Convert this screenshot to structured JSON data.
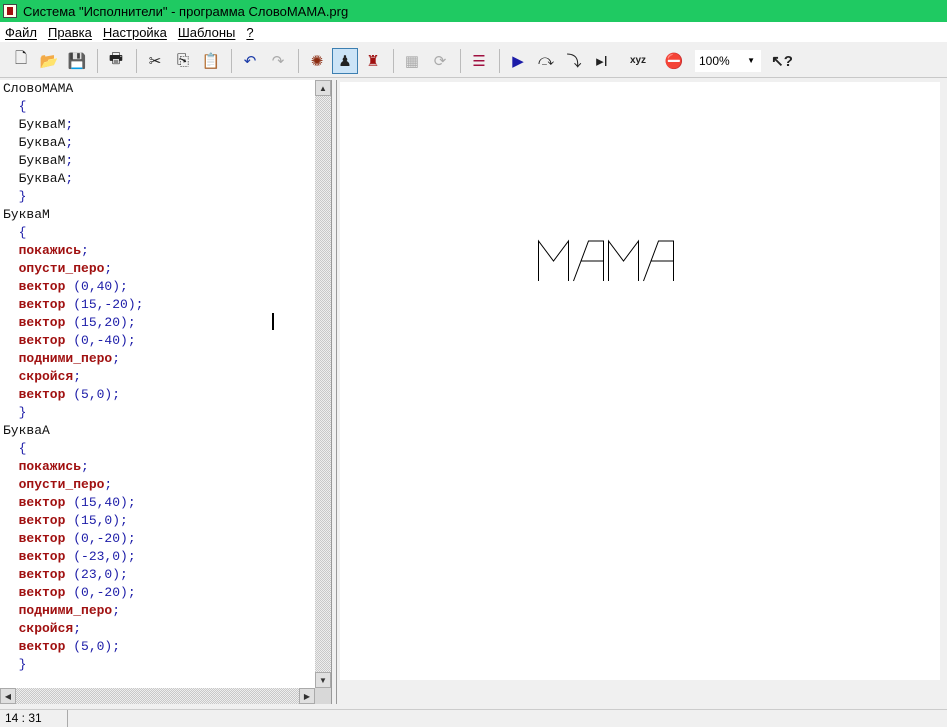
{
  "window": {
    "title": "Система \"Исполнители\" - программа СловоМАМА.prg"
  },
  "menu": [
    "Файл",
    "Правка",
    "Настройка",
    "Шаблоны",
    "?"
  ],
  "toolbar": {
    "zoom": "100%",
    "icons": [
      "new-file-icon",
      "open-folder-icon",
      "save-icon",
      "print-icon",
      "cut-icon",
      "copy-icon",
      "paste-icon",
      "undo-icon",
      "redo-icon",
      "turtle-icon",
      "artist-icon",
      "robot-icon",
      "grid-icon",
      "refresh-icon",
      "format-icon",
      "run-icon",
      "step-over-icon",
      "step-into-icon",
      "run-to-cursor-icon",
      "variables-icon",
      "stop-icon",
      "help-cursor-icon"
    ]
  },
  "code": [
    [
      [
        "pl",
        "СловоМАМА"
      ]
    ],
    [
      [
        "bl",
        "  {"
      ]
    ],
    [
      [
        "pl",
        "  БуквaM"
      ],
      [
        "bl",
        ";"
      ]
    ],
    [
      [
        "pl",
        "  БуквaA"
      ],
      [
        "bl",
        ";"
      ]
    ],
    [
      [
        "pl",
        "  БуквaM"
      ],
      [
        "bl",
        ";"
      ]
    ],
    [
      [
        "pl",
        "  БуквaA"
      ],
      [
        "bl",
        ";"
      ]
    ],
    [
      [
        "bl",
        "  }"
      ]
    ],
    [
      [
        "pl",
        "БуквaM"
      ]
    ],
    [
      [
        "bl",
        "  {"
      ]
    ],
    [
      [
        "kw",
        "  покажись"
      ],
      [
        "bl",
        ";"
      ]
    ],
    [
      [
        "kw",
        "  опусти_перо"
      ],
      [
        "bl",
        ";"
      ]
    ],
    [
      [
        "kw",
        "  вектор"
      ],
      [
        "bl",
        " (0,40);"
      ]
    ],
    [
      [
        "kw",
        "  вектор"
      ],
      [
        "bl",
        " (15,-20);"
      ]
    ],
    [
      [
        "kw",
        "  вектор"
      ],
      [
        "bl",
        " (15,20);"
      ]
    ],
    [
      [
        "kw",
        "  вектор"
      ],
      [
        "bl",
        " (0,-40);"
      ]
    ],
    [
      [
        "kw",
        "  подними_перо"
      ],
      [
        "bl",
        ";"
      ]
    ],
    [
      [
        "kw",
        "  скройся"
      ],
      [
        "bl",
        ";"
      ]
    ],
    [
      [
        "kw",
        "  вектор"
      ],
      [
        "bl",
        " (5,0);"
      ]
    ],
    [
      [
        "bl",
        "  }"
      ]
    ],
    [
      [
        "pl",
        "БуквaA"
      ]
    ],
    [
      [
        "bl",
        "  {"
      ]
    ],
    [
      [
        "kw",
        "  покажись"
      ],
      [
        "bl",
        ";"
      ]
    ],
    [
      [
        "kw",
        "  опусти_перо"
      ],
      [
        "bl",
        ";"
      ]
    ],
    [
      [
        "kw",
        "  вектор"
      ],
      [
        "bl",
        " (15,40);"
      ]
    ],
    [
      [
        "kw",
        "  вектор"
      ],
      [
        "bl",
        " (15,0);"
      ]
    ],
    [
      [
        "kw",
        "  вектор"
      ],
      [
        "bl",
        " (0,-20);"
      ]
    ],
    [
      [
        "kw",
        "  вектор"
      ],
      [
        "bl",
        " (-23,0);"
      ]
    ],
    [
      [
        "kw",
        "  вектор"
      ],
      [
        "bl",
        " (23,0);"
      ]
    ],
    [
      [
        "kw",
        "  вектор"
      ],
      [
        "bl",
        " (0,-20);"
      ]
    ],
    [
      [
        "kw",
        "  подними_перо"
      ],
      [
        "bl",
        ";"
      ]
    ],
    [
      [
        "kw",
        "  скройся"
      ],
      [
        "bl",
        ";"
      ]
    ],
    [
      [
        "kw",
        "  вектор"
      ],
      [
        "bl",
        " (5,0);"
      ]
    ],
    [
      [
        "bl",
        "  }"
      ]
    ]
  ],
  "status": {
    "cursor": "14 : 31"
  },
  "colors": {
    "titlebar": "#1fca62",
    "keyword": "#a01010",
    "punct": "#1c1ca8"
  }
}
